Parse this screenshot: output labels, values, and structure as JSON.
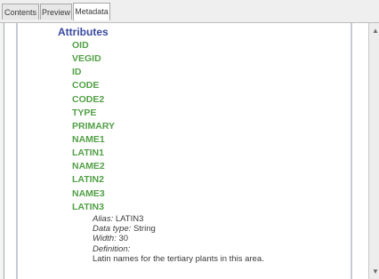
{
  "tabs": [
    {
      "label": "Contents"
    },
    {
      "label": "Preview"
    },
    {
      "label": "Metadata"
    }
  ],
  "metadata": {
    "heading": "Attributes",
    "attributes": [
      "OID",
      "VEGID",
      "ID",
      "CODE",
      "CODE2",
      "TYPE",
      "PRIMARY",
      "NAME1",
      "LATIN1",
      "NAME2",
      "LATIN2",
      "NAME3",
      "LATIN3"
    ],
    "selected": {
      "alias_label": "Alias:",
      "alias_value": "LATIN3",
      "type_label": "Data type:",
      "type_value": "String",
      "width_label": "Width:",
      "width_value": "30",
      "definition_label": "Definition:",
      "definition_text": "Latin names for the tertiary plants in this area."
    }
  },
  "colors": {
    "heading": "#3a4aa0",
    "attribute": "#52a046"
  }
}
